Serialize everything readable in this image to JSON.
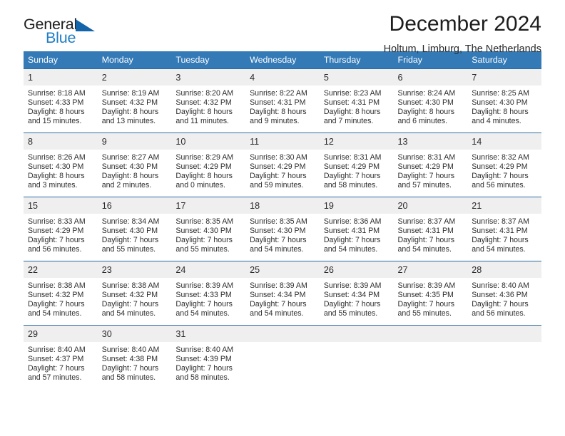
{
  "brand": {
    "name_part1": "General",
    "name_part2": "Blue",
    "triangle_color": "#1464aa",
    "blue_text_color": "#1f7dc4"
  },
  "header": {
    "title": "December 2024",
    "subtitle": "Holtum, Limburg, The Netherlands"
  },
  "theme": {
    "header_blue": "#337ab7",
    "row_divider_blue": "#2c6ca5",
    "daynum_background": "#efefef"
  },
  "calendar": {
    "weekday_headers": [
      "Sunday",
      "Monday",
      "Tuesday",
      "Wednesday",
      "Thursday",
      "Friday",
      "Saturday"
    ],
    "weeks": [
      [
        {
          "day": "1",
          "sunrise": "Sunrise: 8:18 AM",
          "sunset": "Sunset: 4:33 PM",
          "daylight_line1": "Daylight: 8 hours",
          "daylight_line2": "and 15 minutes."
        },
        {
          "day": "2",
          "sunrise": "Sunrise: 8:19 AM",
          "sunset": "Sunset: 4:32 PM",
          "daylight_line1": "Daylight: 8 hours",
          "daylight_line2": "and 13 minutes."
        },
        {
          "day": "3",
          "sunrise": "Sunrise: 8:20 AM",
          "sunset": "Sunset: 4:32 PM",
          "daylight_line1": "Daylight: 8 hours",
          "daylight_line2": "and 11 minutes."
        },
        {
          "day": "4",
          "sunrise": "Sunrise: 8:22 AM",
          "sunset": "Sunset: 4:31 PM",
          "daylight_line1": "Daylight: 8 hours",
          "daylight_line2": "and 9 minutes."
        },
        {
          "day": "5",
          "sunrise": "Sunrise: 8:23 AM",
          "sunset": "Sunset: 4:31 PM",
          "daylight_line1": "Daylight: 8 hours",
          "daylight_line2": "and 7 minutes."
        },
        {
          "day": "6",
          "sunrise": "Sunrise: 8:24 AM",
          "sunset": "Sunset: 4:30 PM",
          "daylight_line1": "Daylight: 8 hours",
          "daylight_line2": "and 6 minutes."
        },
        {
          "day": "7",
          "sunrise": "Sunrise: 8:25 AM",
          "sunset": "Sunset: 4:30 PM",
          "daylight_line1": "Daylight: 8 hours",
          "daylight_line2": "and 4 minutes."
        }
      ],
      [
        {
          "day": "8",
          "sunrise": "Sunrise: 8:26 AM",
          "sunset": "Sunset: 4:30 PM",
          "daylight_line1": "Daylight: 8 hours",
          "daylight_line2": "and 3 minutes."
        },
        {
          "day": "9",
          "sunrise": "Sunrise: 8:27 AM",
          "sunset": "Sunset: 4:30 PM",
          "daylight_line1": "Daylight: 8 hours",
          "daylight_line2": "and 2 minutes."
        },
        {
          "day": "10",
          "sunrise": "Sunrise: 8:29 AM",
          "sunset": "Sunset: 4:29 PM",
          "daylight_line1": "Daylight: 8 hours",
          "daylight_line2": "and 0 minutes."
        },
        {
          "day": "11",
          "sunrise": "Sunrise: 8:30 AM",
          "sunset": "Sunset: 4:29 PM",
          "daylight_line1": "Daylight: 7 hours",
          "daylight_line2": "and 59 minutes."
        },
        {
          "day": "12",
          "sunrise": "Sunrise: 8:31 AM",
          "sunset": "Sunset: 4:29 PM",
          "daylight_line1": "Daylight: 7 hours",
          "daylight_line2": "and 58 minutes."
        },
        {
          "day": "13",
          "sunrise": "Sunrise: 8:31 AM",
          "sunset": "Sunset: 4:29 PM",
          "daylight_line1": "Daylight: 7 hours",
          "daylight_line2": "and 57 minutes."
        },
        {
          "day": "14",
          "sunrise": "Sunrise: 8:32 AM",
          "sunset": "Sunset: 4:29 PM",
          "daylight_line1": "Daylight: 7 hours",
          "daylight_line2": "and 56 minutes."
        }
      ],
      [
        {
          "day": "15",
          "sunrise": "Sunrise: 8:33 AM",
          "sunset": "Sunset: 4:29 PM",
          "daylight_line1": "Daylight: 7 hours",
          "daylight_line2": "and 56 minutes."
        },
        {
          "day": "16",
          "sunrise": "Sunrise: 8:34 AM",
          "sunset": "Sunset: 4:30 PM",
          "daylight_line1": "Daylight: 7 hours",
          "daylight_line2": "and 55 minutes."
        },
        {
          "day": "17",
          "sunrise": "Sunrise: 8:35 AM",
          "sunset": "Sunset: 4:30 PM",
          "daylight_line1": "Daylight: 7 hours",
          "daylight_line2": "and 55 minutes."
        },
        {
          "day": "18",
          "sunrise": "Sunrise: 8:35 AM",
          "sunset": "Sunset: 4:30 PM",
          "daylight_line1": "Daylight: 7 hours",
          "daylight_line2": "and 54 minutes."
        },
        {
          "day": "19",
          "sunrise": "Sunrise: 8:36 AM",
          "sunset": "Sunset: 4:31 PM",
          "daylight_line1": "Daylight: 7 hours",
          "daylight_line2": "and 54 minutes."
        },
        {
          "day": "20",
          "sunrise": "Sunrise: 8:37 AM",
          "sunset": "Sunset: 4:31 PM",
          "daylight_line1": "Daylight: 7 hours",
          "daylight_line2": "and 54 minutes."
        },
        {
          "day": "21",
          "sunrise": "Sunrise: 8:37 AM",
          "sunset": "Sunset: 4:31 PM",
          "daylight_line1": "Daylight: 7 hours",
          "daylight_line2": "and 54 minutes."
        }
      ],
      [
        {
          "day": "22",
          "sunrise": "Sunrise: 8:38 AM",
          "sunset": "Sunset: 4:32 PM",
          "daylight_line1": "Daylight: 7 hours",
          "daylight_line2": "and 54 minutes."
        },
        {
          "day": "23",
          "sunrise": "Sunrise: 8:38 AM",
          "sunset": "Sunset: 4:32 PM",
          "daylight_line1": "Daylight: 7 hours",
          "daylight_line2": "and 54 minutes."
        },
        {
          "day": "24",
          "sunrise": "Sunrise: 8:39 AM",
          "sunset": "Sunset: 4:33 PM",
          "daylight_line1": "Daylight: 7 hours",
          "daylight_line2": "and 54 minutes."
        },
        {
          "day": "25",
          "sunrise": "Sunrise: 8:39 AM",
          "sunset": "Sunset: 4:34 PM",
          "daylight_line1": "Daylight: 7 hours",
          "daylight_line2": "and 54 minutes."
        },
        {
          "day": "26",
          "sunrise": "Sunrise: 8:39 AM",
          "sunset": "Sunset: 4:34 PM",
          "daylight_line1": "Daylight: 7 hours",
          "daylight_line2": "and 55 minutes."
        },
        {
          "day": "27",
          "sunrise": "Sunrise: 8:39 AM",
          "sunset": "Sunset: 4:35 PM",
          "daylight_line1": "Daylight: 7 hours",
          "daylight_line2": "and 55 minutes."
        },
        {
          "day": "28",
          "sunrise": "Sunrise: 8:40 AM",
          "sunset": "Sunset: 4:36 PM",
          "daylight_line1": "Daylight: 7 hours",
          "daylight_line2": "and 56 minutes."
        }
      ],
      [
        {
          "day": "29",
          "sunrise": "Sunrise: 8:40 AM",
          "sunset": "Sunset: 4:37 PM",
          "daylight_line1": "Daylight: 7 hours",
          "daylight_line2": "and 57 minutes."
        },
        {
          "day": "30",
          "sunrise": "Sunrise: 8:40 AM",
          "sunset": "Sunset: 4:38 PM",
          "daylight_line1": "Daylight: 7 hours",
          "daylight_line2": "and 58 minutes."
        },
        {
          "day": "31",
          "sunrise": "Sunrise: 8:40 AM",
          "sunset": "Sunset: 4:39 PM",
          "daylight_line1": "Daylight: 7 hours",
          "daylight_line2": "and 58 minutes."
        },
        {
          "day": "",
          "sunrise": "",
          "sunset": "",
          "daylight_line1": "",
          "daylight_line2": ""
        },
        {
          "day": "",
          "sunrise": "",
          "sunset": "",
          "daylight_line1": "",
          "daylight_line2": ""
        },
        {
          "day": "",
          "sunrise": "",
          "sunset": "",
          "daylight_line1": "",
          "daylight_line2": ""
        },
        {
          "day": "",
          "sunrise": "",
          "sunset": "",
          "daylight_line1": "",
          "daylight_line2": ""
        }
      ]
    ]
  }
}
